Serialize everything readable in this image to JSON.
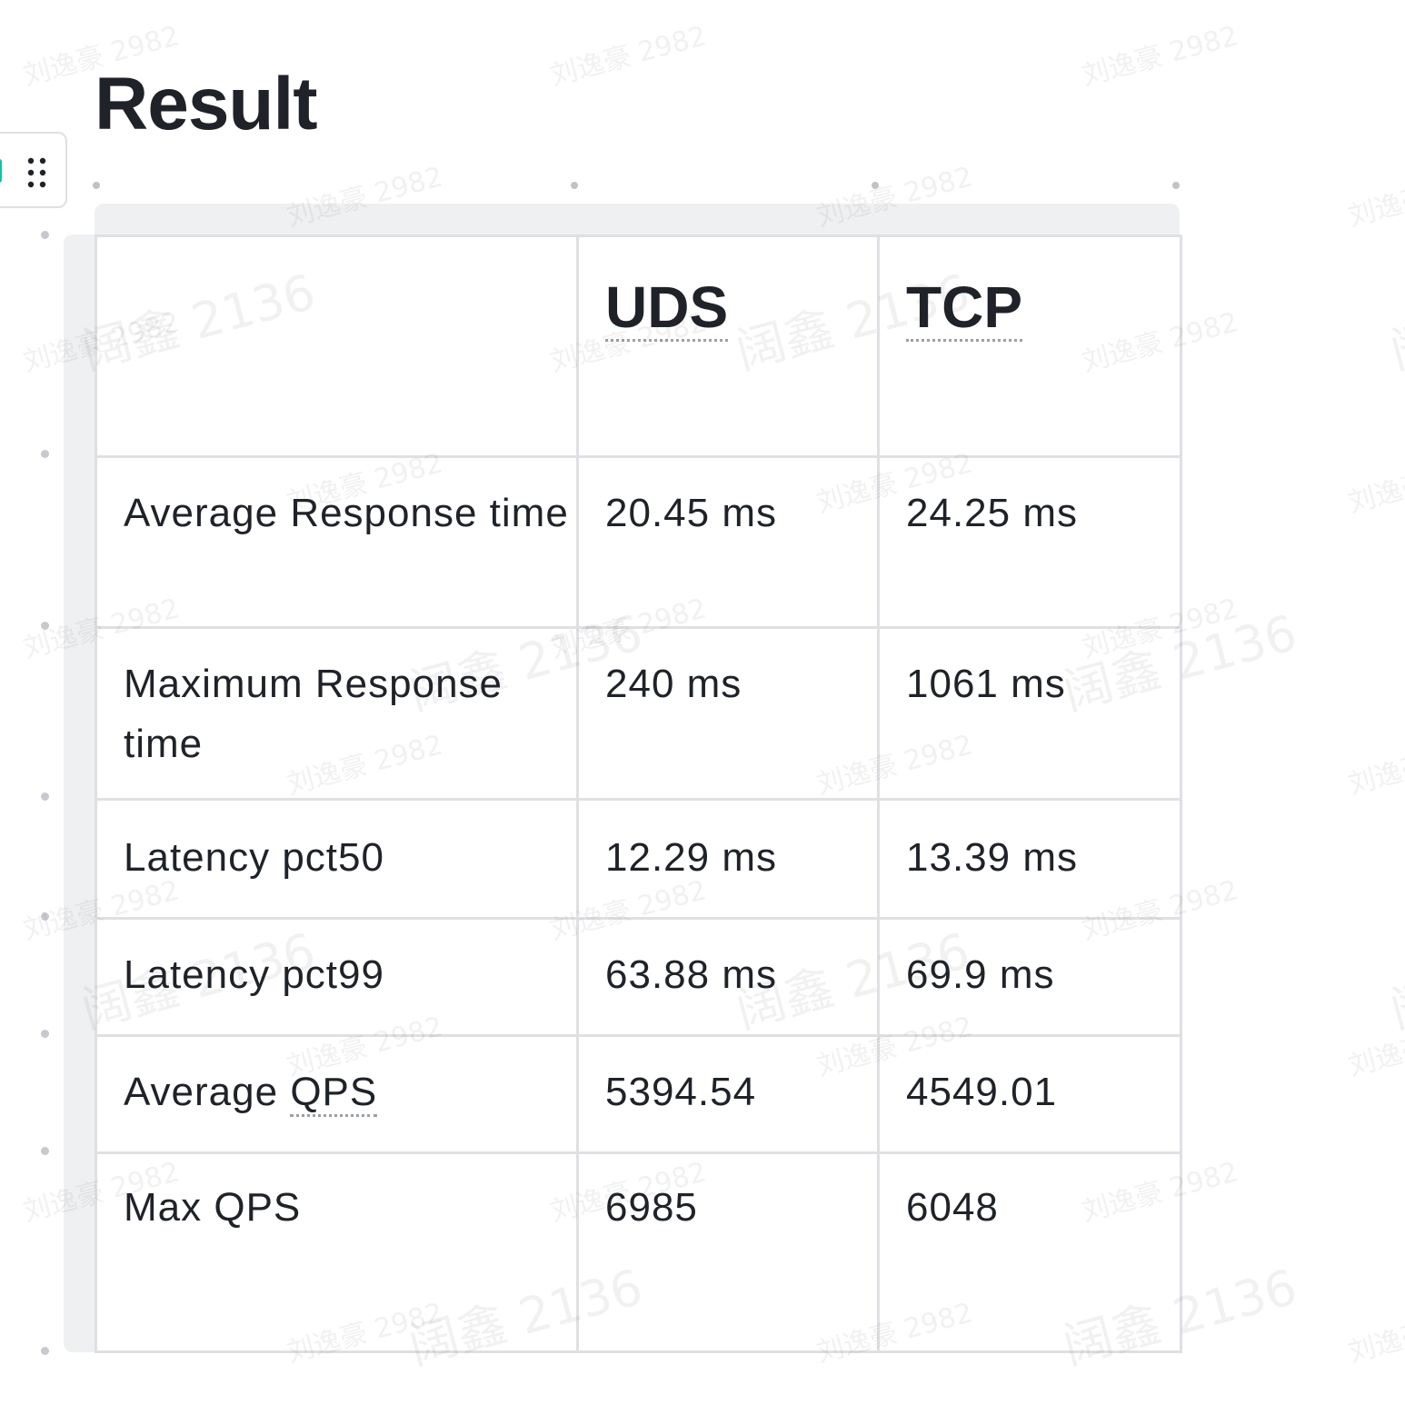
{
  "page": {
    "heading": "Result"
  },
  "table": {
    "header": {
      "blank": "",
      "col1": "UDS",
      "col2": "TCP"
    },
    "rows": [
      {
        "label": "Average Response time",
        "uds": "20.45 ms",
        "tcp": "24.25 ms"
      },
      {
        "label": "Maximum Response time",
        "uds": "240 ms",
        "tcp": "1061 ms"
      },
      {
        "label": "Latency pct50",
        "uds": "12.29 ms",
        "tcp": "13.39 ms"
      },
      {
        "label": "Latency pct99",
        "uds": "63.88 ms",
        "tcp": "69.9 ms"
      },
      {
        "label_prefix": "Average ",
        "label_marked": "QPS",
        "uds": "5394.54",
        "tcp": "4549.01"
      },
      {
        "label": "Max QPS",
        "uds": "6985",
        "tcp": "6048"
      }
    ]
  },
  "watermarks": {
    "user_a": "刘逸豪 2982",
    "user_b": "阔鑫 2136"
  },
  "colors": {
    "text": "#1f2329",
    "border": "#dee0e3",
    "frame": "#eff0f1",
    "accent": "#14c0a0"
  },
  "icons": {
    "block_handle": "drag-handle-icon",
    "block_type": "table-icon"
  }
}
